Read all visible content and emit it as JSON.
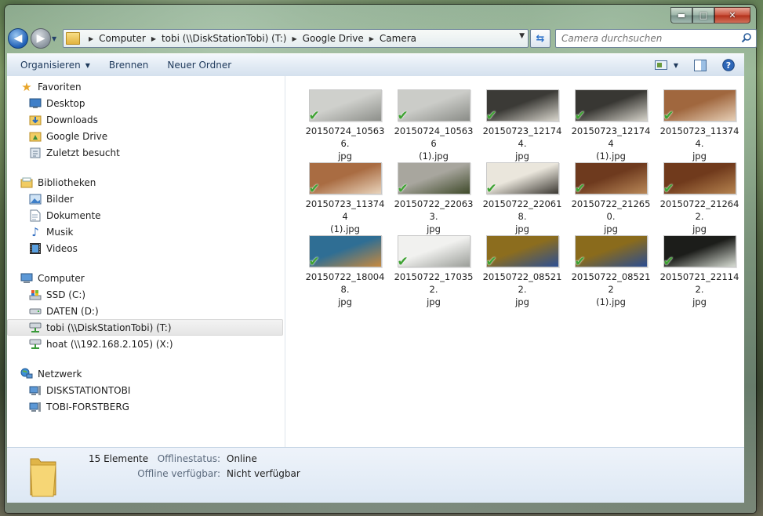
{
  "window": {
    "minimize_label": "▬",
    "maximize_label": "□",
    "close_label": "✕"
  },
  "address": {
    "crumbs": [
      "Computer",
      "tobi (\\\\DiskStationTobi) (T:)",
      "Google Drive",
      "Camera"
    ]
  },
  "search": {
    "placeholder": "Camera durchsuchen"
  },
  "toolbar": {
    "organize": "Organisieren",
    "burn": "Brennen",
    "new_folder": "Neuer Ordner"
  },
  "nav": {
    "favorites": {
      "label": "Favoriten",
      "items": [
        {
          "label": "Desktop",
          "icon": "desktop-icon"
        },
        {
          "label": "Downloads",
          "icon": "downloads-folder-icon"
        },
        {
          "label": "Google Drive",
          "icon": "google-drive-folder-icon"
        },
        {
          "label": "Zuletzt besucht",
          "icon": "recent-places-icon"
        }
      ]
    },
    "libraries": {
      "label": "Bibliotheken",
      "items": [
        {
          "label": "Bilder",
          "icon": "pictures-icon"
        },
        {
          "label": "Dokumente",
          "icon": "documents-icon"
        },
        {
          "label": "Musik",
          "icon": "music-icon"
        },
        {
          "label": "Videos",
          "icon": "videos-icon"
        }
      ]
    },
    "computer": {
      "label": "Computer",
      "items": [
        {
          "label": "SSD (C:)",
          "icon": "system-drive-icon"
        },
        {
          "label": "DATEN (D:)",
          "icon": "hard-drive-icon"
        },
        {
          "label": "tobi (\\\\DiskStationTobi) (T:)",
          "icon": "network-drive-icon",
          "selected": true
        },
        {
          "label": "hoat (\\\\192.168.2.105) (X:)",
          "icon": "network-drive-icon"
        }
      ]
    },
    "network": {
      "label": "Netzwerk",
      "items": [
        {
          "label": "DISKSTATIONTOBI",
          "icon": "network-computer-icon"
        },
        {
          "label": "TOBI-FORSTBERG",
          "icon": "network-computer-icon"
        }
      ]
    }
  },
  "files": [
    {
      "name": "20150724_105636.jpg",
      "line1": "20150724_105636.",
      "line2": "jpg",
      "colors": [
        "#cfd0cc",
        "#8d8f8a"
      ]
    },
    {
      "name": "20150724_105636 (1).jpg",
      "line1": "20150724_105636",
      "line2": "(1).jpg",
      "colors": [
        "#cbccc8",
        "#8a8c87"
      ]
    },
    {
      "name": "20150723_121744.jpg",
      "line1": "20150723_121744.",
      "line2": "jpg",
      "colors": [
        "#3b3a36",
        "#d9d6cd"
      ]
    },
    {
      "name": "20150723_121744 (1).jpg",
      "line1": "20150723_121744",
      "line2": "(1).jpg",
      "colors": [
        "#383733",
        "#d6d3ca"
      ]
    },
    {
      "name": "20150723_113744.jpg",
      "line1": "20150723_113744.",
      "line2": "jpg",
      "colors": [
        "#a0673e",
        "#e6cfb6"
      ]
    },
    {
      "name": "20150723_113744 (1).jpg",
      "line1": "20150723_113744",
      "line2": "(1).jpg",
      "colors": [
        "#a96c42",
        "#e9d4bc"
      ]
    },
    {
      "name": "20150722_220633.jpg",
      "line1": "20150722_220633.",
      "line2": "jpg",
      "colors": [
        "#a8a69e",
        "#3f4a2a"
      ]
    },
    {
      "name": "20150722_220618.jpg",
      "line1": "20150722_220618.",
      "line2": "jpg",
      "colors": [
        "#eae6dc",
        "#3b3832"
      ]
    },
    {
      "name": "20150722_212650.jpg",
      "line1": "20150722_212650.",
      "line2": "jpg",
      "colors": [
        "#6e3a1e",
        "#b98858"
      ]
    },
    {
      "name": "20150722_212642.jpg",
      "line1": "20150722_212642.",
      "line2": "jpg",
      "colors": [
        "#703a1c",
        "#b5834f"
      ]
    },
    {
      "name": "20150722_180048.jpg",
      "line1": "20150722_180048.",
      "line2": "jpg",
      "colors": [
        "#2f6e94",
        "#c8893e"
      ]
    },
    {
      "name": "20150722_170352.jpg",
      "line1": "20150722_170352.",
      "line2": "jpg",
      "colors": [
        "#f1f1ef",
        "#9b9e99"
      ]
    },
    {
      "name": "20150722_085212.jpg",
      "line1": "20150722_085212.",
      "line2": "jpg",
      "colors": [
        "#8c6d1e",
        "#2d4f94"
      ]
    },
    {
      "name": "20150722_085212 (1).jpg",
      "line1": "20150722_085212",
      "line2": "(1).jpg",
      "colors": [
        "#8a6b1c",
        "#2b4d92"
      ]
    },
    {
      "name": "20150721_221142.jpg",
      "line1": "20150721_221142.",
      "line2": "jpg",
      "colors": [
        "#1c1d1a",
        "#d8ddd4"
      ]
    }
  ],
  "details": {
    "count": "15 Elemente",
    "offline_status_label": "Offlinestatus:",
    "offline_status_value": "Online",
    "offline_available_label": "Offline verfügbar:",
    "offline_available_value": "Nicht verfügbar"
  }
}
